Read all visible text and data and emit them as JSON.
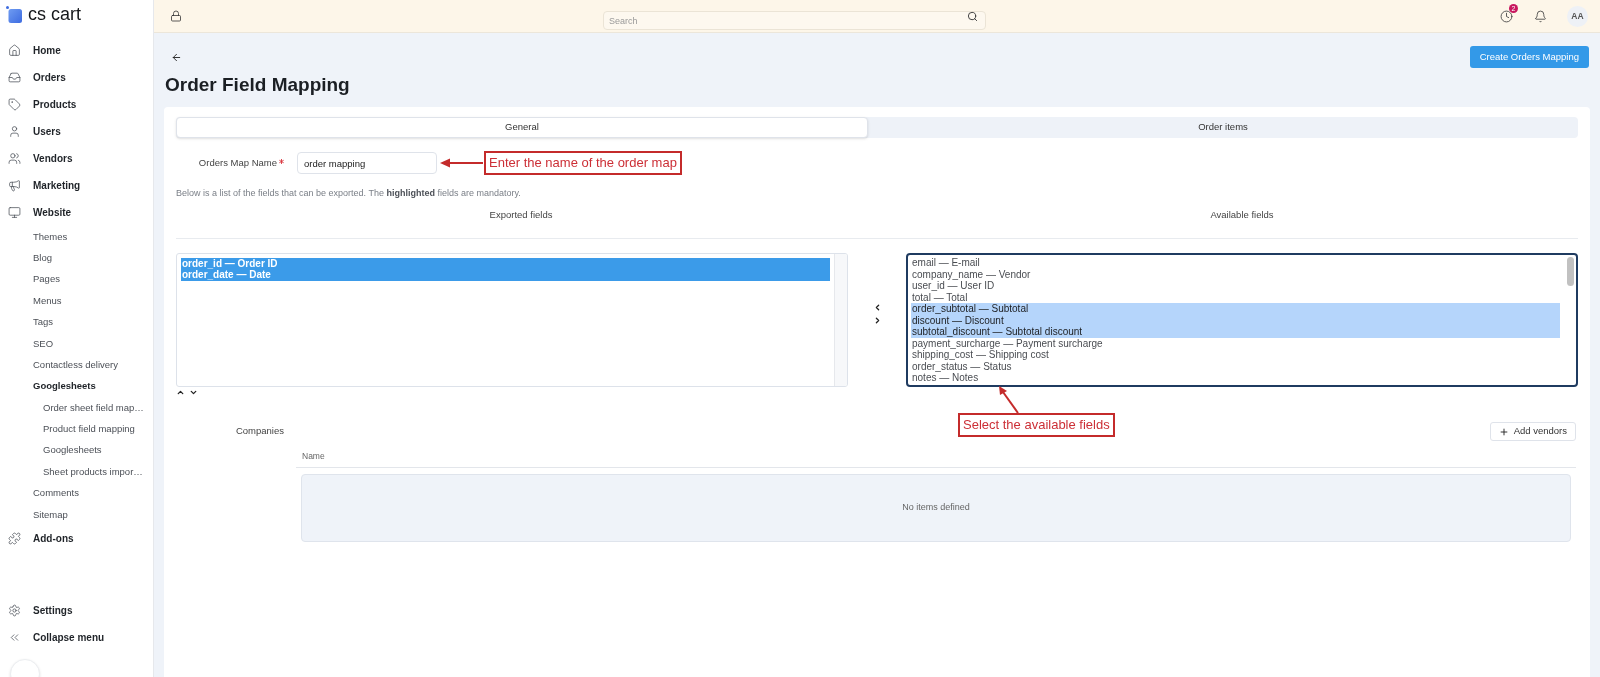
{
  "sidebar": {
    "logo": "cs cart",
    "items": [
      {
        "label": "Home"
      },
      {
        "label": "Orders"
      },
      {
        "label": "Products"
      },
      {
        "label": "Users"
      },
      {
        "label": "Vendors"
      },
      {
        "label": "Marketing"
      },
      {
        "label": "Website",
        "children": [
          {
            "label": "Themes",
            "expanded": false
          },
          {
            "label": "Blog",
            "expanded": false
          },
          {
            "label": "Pages",
            "expanded": false
          },
          {
            "label": "Menus",
            "expanded": false
          },
          {
            "label": "Tags",
            "expanded": false
          },
          {
            "label": "SEO",
            "expanded": false
          },
          {
            "label": "Contactless delivery",
            "expanded": false
          },
          {
            "label": "Googlesheets",
            "expanded": true,
            "children": [
              {
                "label": "Order sheet field map…"
              },
              {
                "label": "Product field mapping"
              },
              {
                "label": "Googlesheets"
              },
              {
                "label": "Sheet products impor…"
              }
            ]
          },
          {
            "label": "Comments",
            "expanded": false
          },
          {
            "label": "Sitemap",
            "expanded": false
          }
        ]
      },
      {
        "label": "Add-ons"
      }
    ],
    "bottom_items": [
      {
        "label": "Settings"
      },
      {
        "label": "Collapse menu"
      }
    ]
  },
  "top_bar": {
    "search": {
      "placeholder": "Search"
    },
    "notification_count": "2",
    "avatar": "AA"
  },
  "page": {
    "title": "Order Field Mapping",
    "create_button": "Create Orders Mapping"
  },
  "tabs": [
    {
      "label": "General",
      "selected": true
    },
    {
      "label": "Order items",
      "selected": false
    }
  ],
  "form": {
    "map_name": {
      "label": "Orders Map Name",
      "required": true,
      "value": "order mapping"
    },
    "hint": "Below is a list of the fields that can be exported. The **highlighted** fields are mandatory."
  },
  "exported_fields": {
    "heading": "Exported fields",
    "options": [
      {
        "label": "order_id — Order ID",
        "selected": true,
        "mandatory": true
      },
      {
        "label": "order_date — Date",
        "selected": true,
        "mandatory": true
      }
    ]
  },
  "available_fields": {
    "heading": "Available fields",
    "options": [
      {
        "label": "email — E-mail",
        "selected": false,
        "mandatory": false
      },
      {
        "label": "company_name — Vendor",
        "selected": false,
        "mandatory": false
      },
      {
        "label": "user_id — User ID",
        "selected": false,
        "mandatory": false
      },
      {
        "label": "total — Total",
        "selected": false,
        "mandatory": false
      },
      {
        "label": "order_subtotal — Subtotal",
        "selected": true,
        "mandatory": false
      },
      {
        "label": "discount — Discount",
        "selected": true,
        "mandatory": false
      },
      {
        "label": "subtotal_discount — Subtotal discount",
        "selected": true,
        "mandatory": false
      },
      {
        "label": "payment_surcharge — Payment surcharge",
        "selected": false,
        "mandatory": false
      },
      {
        "label": "shipping_cost — Shipping cost",
        "selected": false,
        "mandatory": false
      },
      {
        "label": "order_status — Status",
        "selected": false,
        "mandatory": false
      },
      {
        "label": "notes — Notes",
        "selected": false,
        "mandatory": false
      }
    ]
  },
  "companies": {
    "label": "Companies",
    "add_button": "Add vendors",
    "columns": [
      "Name"
    ],
    "empty_text": "No items defined"
  },
  "annotations": [
    {
      "text": "Enter the name of the order map"
    },
    {
      "text": "Select the available fields"
    }
  ]
}
